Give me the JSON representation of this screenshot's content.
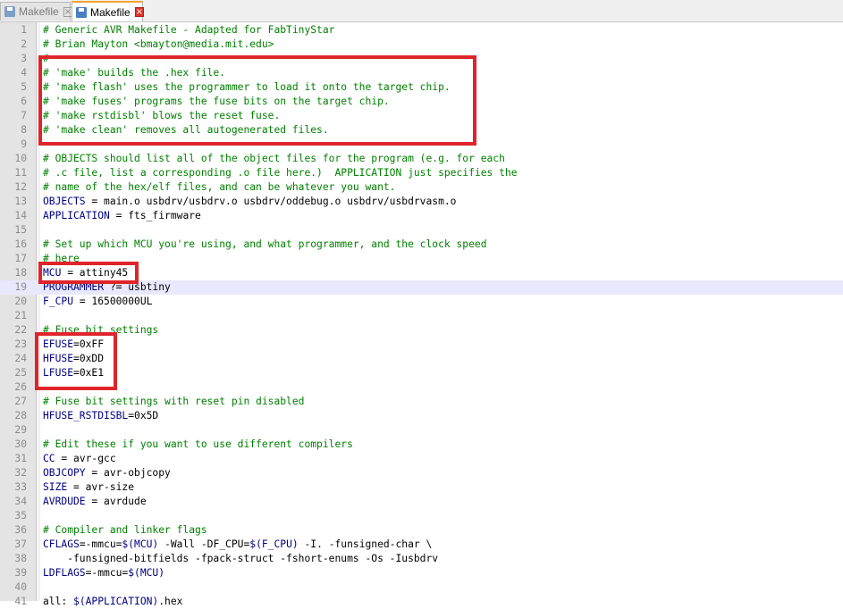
{
  "tabs": [
    {
      "label": "Makefile",
      "active": false
    },
    {
      "label": "Makefile",
      "active": true
    }
  ],
  "icons": {
    "tab_icon": "save-disk-icon",
    "close_icon": "close-icon"
  },
  "colors": {
    "comment": "#008000",
    "variable": "#000080",
    "text": "#000000",
    "highlight_box": "#e0242b",
    "current_line": "#e8e8ff"
  },
  "current_line": 19,
  "lines": [
    {
      "n": "1",
      "t": "comment",
      "text": "# Generic AVR Makefile - Adapted for FabTinyStar"
    },
    {
      "n": "2",
      "t": "comment",
      "text": "# Brian Mayton <bmayton@media.mit.edu>"
    },
    {
      "n": "3",
      "t": "comment",
      "text": "#"
    },
    {
      "n": "4",
      "t": "comment",
      "text": "# 'make' builds the .hex file."
    },
    {
      "n": "5",
      "t": "comment",
      "text": "# 'make flash' uses the programmer to load it onto the target chip."
    },
    {
      "n": "6",
      "t": "comment",
      "text": "# 'make fuses' programs the fuse bits on the target chip."
    },
    {
      "n": "7",
      "t": "comment",
      "text": "# 'make rstdisbl' blows the reset fuse."
    },
    {
      "n": "8",
      "t": "comment",
      "text": "# 'make clean' removes all autogenerated files."
    },
    {
      "n": "9",
      "t": "plain",
      "text": ""
    },
    {
      "n": "10",
      "t": "comment",
      "text": "# OBJECTS should list all of the object files for the program (e.g. for each"
    },
    {
      "n": "11",
      "t": "comment",
      "text": "# .c file, list a corresponding .o file here.)  APPLICATION just specifies the"
    },
    {
      "n": "12",
      "t": "comment",
      "text": "# name of the hex/elf files, and can be whatever you want."
    },
    {
      "n": "13",
      "t": "assign",
      "var": "OBJECTS",
      "rest": " = main.o usbdrv/usbdrv.o usbdrv/oddebug.o usbdrv/usbdrvasm.o"
    },
    {
      "n": "14",
      "t": "assign",
      "var": "APPLICATION",
      "rest": " = fts_firmware"
    },
    {
      "n": "15",
      "t": "plain",
      "text": ""
    },
    {
      "n": "16",
      "t": "comment",
      "text": "# Set up which MCU you're using, and what programmer, and the clock speed"
    },
    {
      "n": "17",
      "t": "comment",
      "text": "# here"
    },
    {
      "n": "18",
      "t": "assign",
      "var": "MCU",
      "rest": " = attiny45"
    },
    {
      "n": "19",
      "t": "assign",
      "var": "PROGRAMMER",
      "rest": " ?= usbtiny"
    },
    {
      "n": "20",
      "t": "assign",
      "var": "F_CPU",
      "rest": " = 16500000UL"
    },
    {
      "n": "21",
      "t": "plain",
      "text": ""
    },
    {
      "n": "22",
      "t": "comment",
      "text": "# Fuse bit settings"
    },
    {
      "n": "23",
      "t": "assign",
      "var": "EFUSE",
      "rest": "=0xFF"
    },
    {
      "n": "24",
      "t": "assign",
      "var": "HFUSE",
      "rest": "=0xDD"
    },
    {
      "n": "25",
      "t": "assign",
      "var": "LFUSE",
      "rest": "=0xE1"
    },
    {
      "n": "26",
      "t": "plain",
      "text": ""
    },
    {
      "n": "27",
      "t": "comment",
      "text": "# Fuse bit settings with reset pin disabled"
    },
    {
      "n": "28",
      "t": "assign",
      "var": "HFUSE_RSTDISBL",
      "rest": "=0x5D"
    },
    {
      "n": "29",
      "t": "plain",
      "text": ""
    },
    {
      "n": "30",
      "t": "comment",
      "text": "# Edit these if you want to use different compilers"
    },
    {
      "n": "31",
      "t": "assign",
      "var": "CC",
      "rest": " = avr-gcc"
    },
    {
      "n": "32",
      "t": "assign",
      "var": "OBJCOPY",
      "rest": " = avr-objcopy"
    },
    {
      "n": "33",
      "t": "assign",
      "var": "SIZE",
      "rest": " = avr-size"
    },
    {
      "n": "34",
      "t": "assign",
      "var": "AVRDUDE",
      "rest": " = avrdude"
    },
    {
      "n": "35",
      "t": "plain",
      "text": ""
    },
    {
      "n": "36",
      "t": "comment",
      "text": "# Compiler and linker flags"
    },
    {
      "n": "37",
      "t": "mixed",
      "parts": [
        [
          "var",
          "CFLAGS"
        ],
        [
          "plain",
          "=-mmcu="
        ],
        [
          "var",
          "$(MCU)"
        ],
        [
          "plain",
          " -Wall -DF_CPU="
        ],
        [
          "var",
          "$(F_CPU)"
        ],
        [
          "plain",
          " -I. -funsigned-char \\"
        ]
      ]
    },
    {
      "n": "38",
      "t": "plain",
      "text": "    -funsigned-bitfields -fpack-struct -fshort-enums -Os -Iusbdrv"
    },
    {
      "n": "39",
      "t": "mixed",
      "parts": [
        [
          "var",
          "LDFLAGS"
        ],
        [
          "plain",
          "=-mmcu="
        ],
        [
          "var",
          "$(MCU)"
        ]
      ]
    },
    {
      "n": "40",
      "t": "plain",
      "text": ""
    },
    {
      "n": "41",
      "t": "mixed",
      "parts": [
        [
          "plain",
          "all: "
        ],
        [
          "var",
          "$(APPLICATION)"
        ],
        [
          "plain",
          ".hex"
        ]
      ]
    }
  ]
}
